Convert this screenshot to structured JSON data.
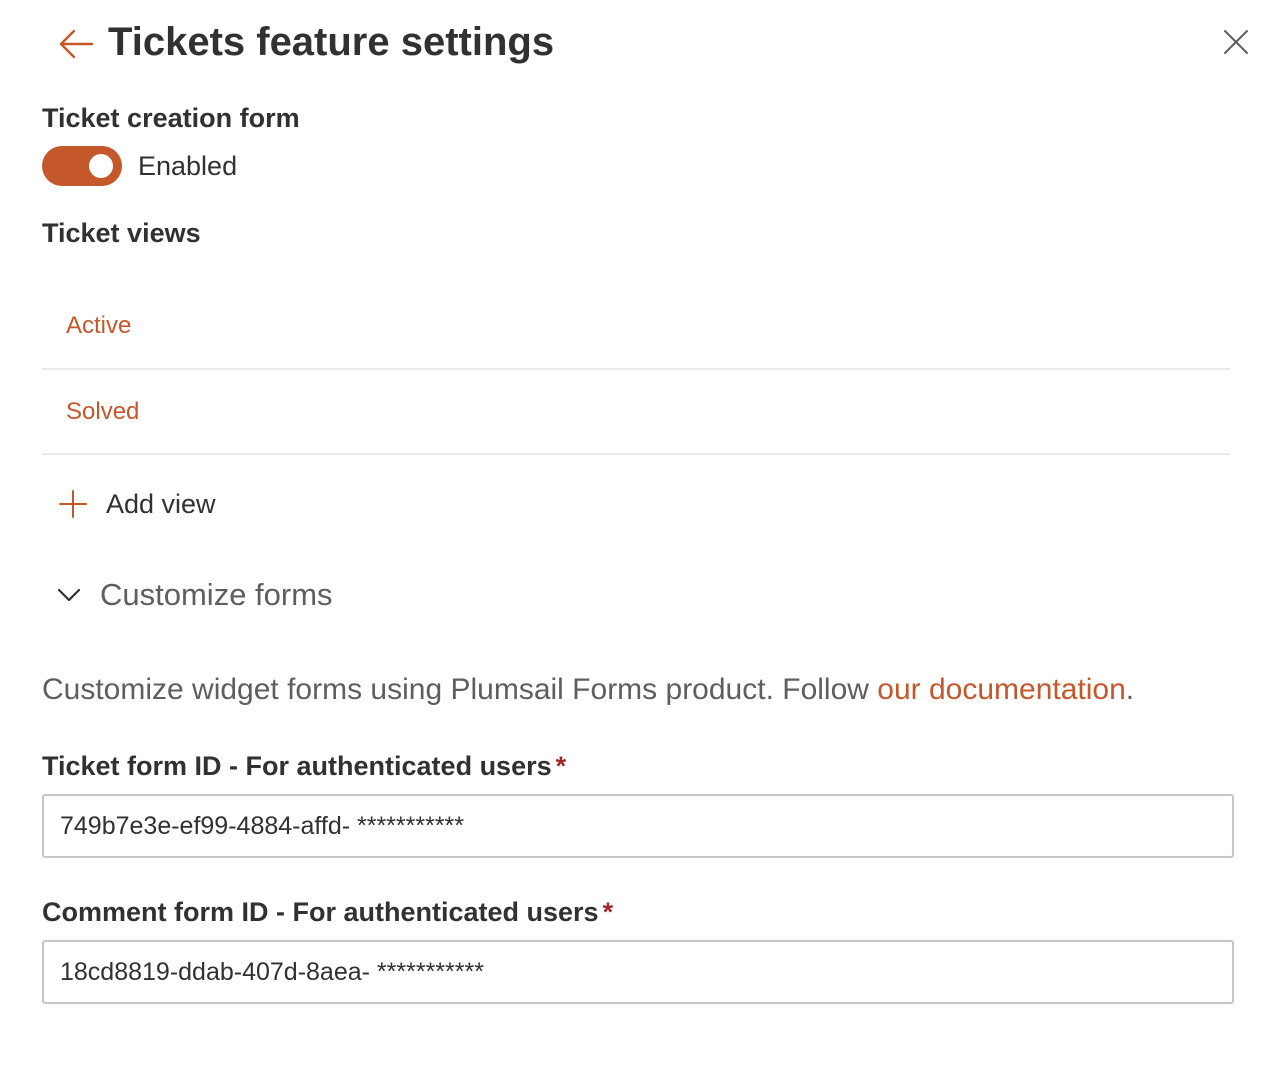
{
  "header": {
    "title": "Tickets feature settings",
    "back_icon": "arrow-left-icon",
    "close_icon": "close-icon",
    "accent_color": "#c4582a"
  },
  "ticket_creation_form": {
    "label": "Ticket creation form",
    "toggle_state": "on",
    "toggle_text": "Enabled"
  },
  "ticket_views": {
    "label": "Ticket views",
    "items": [
      {
        "label": "Active"
      },
      {
        "label": "Solved"
      }
    ],
    "add_view_label": "Add view",
    "add_icon": "plus-icon"
  },
  "customize_forms": {
    "label": "Customize forms",
    "expanded": true,
    "chevron_icon": "chevron-down-icon",
    "description_text": "Customize widget forms using Plumsail Forms product. Follow ",
    "description_link": "our documentation",
    "description_end": "."
  },
  "fields": {
    "ticket_form": {
      "label": "Ticket form ID - For authenticated users",
      "required_mark": "*",
      "value": "749b7e3e-ef99-4884-affd- ***********"
    },
    "comment_form": {
      "label": "Comment form ID - For authenticated users",
      "required_mark": "*",
      "value": "18cd8819-ddab-407d-8aea- ***********"
    }
  }
}
